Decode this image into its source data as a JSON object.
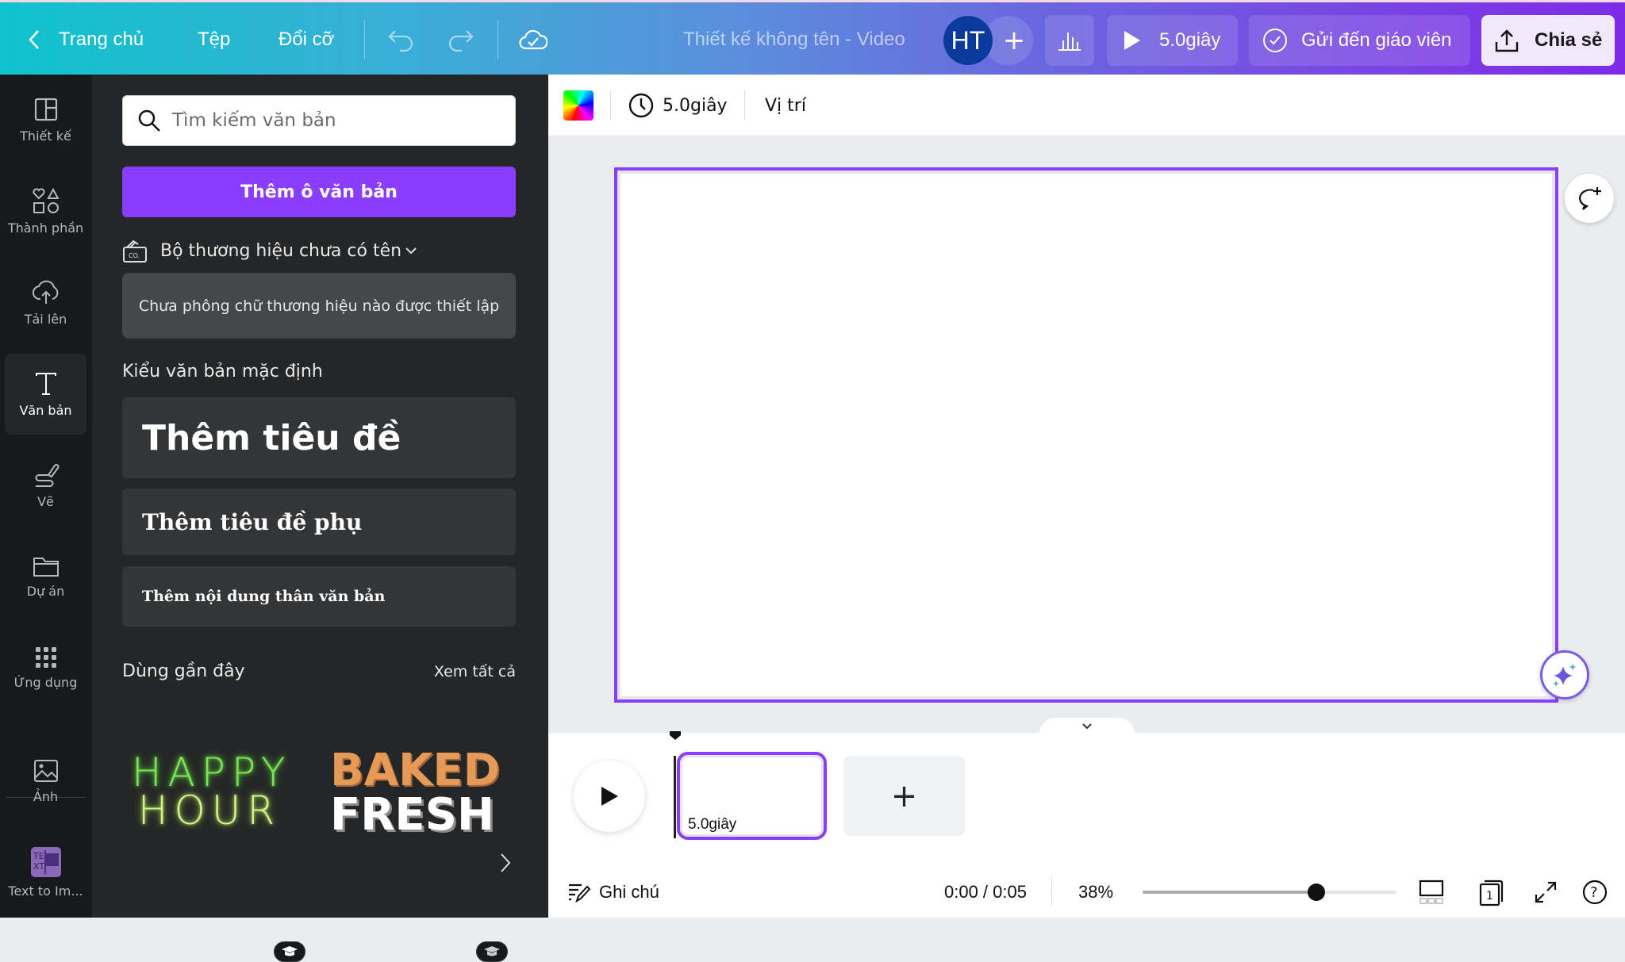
{
  "topbar": {
    "back_label": "Trang chủ",
    "file_label": "Tệp",
    "resize_label": "Đổi cỡ",
    "design_title": "Thiết kế không tên - Video",
    "avatar_initials": "HT",
    "add_collaborator": "+",
    "play_duration": "5.0giây",
    "send_to_teacher": "Gửi đến giáo viên",
    "share_label": "Chia sẻ",
    "colors": {
      "gradient_start": "#0fc3cc",
      "gradient_end": "#7d2ae8",
      "avatar_bg": "#0a3a9c"
    }
  },
  "rail": {
    "items": [
      {
        "label": "Thiết kế",
        "icon": "layout-icon"
      },
      {
        "label": "Thành phần",
        "icon": "elements-icon"
      },
      {
        "label": "Tải lên",
        "icon": "upload-cloud-icon"
      },
      {
        "label": "Văn bản",
        "icon": "text-icon",
        "active": true
      },
      {
        "label": "Vẽ",
        "icon": "draw-icon"
      },
      {
        "label": "Dự án",
        "icon": "folder-icon"
      },
      {
        "label": "Ứng dụng",
        "icon": "apps-grid-icon"
      },
      {
        "label": "Ảnh",
        "icon": "image-icon"
      },
      {
        "label": "Text to Im...",
        "icon": "text-to-image-icon"
      }
    ]
  },
  "panel": {
    "search_placeholder": "Tìm kiếm văn bản",
    "search_value": "",
    "add_textbox": "Thêm ô văn bản",
    "brand_kit": "Bộ thương hiệu chưa có tên",
    "brand_note": "Chưa phông chữ thương hiệu nào được thiết lập",
    "default_styles_title": "Kiểu văn bản mặc định",
    "heading": "Thêm tiêu đề",
    "subheading": "Thêm tiêu đề phụ",
    "body": "Thêm nội dung thân văn bản",
    "recent_title": "Dùng gần đây",
    "see_all": "Xem tất cả",
    "recent": [
      {
        "line1": "HAPPY",
        "line2": "HOUR"
      },
      {
        "line1": "BAKED",
        "line2": "FRESH"
      }
    ],
    "accent": "#8b3dff"
  },
  "context_bar": {
    "duration": "5.0giây",
    "position": "Vị trí"
  },
  "timeline": {
    "scene_duration": "5.0giây",
    "add_scene": "+"
  },
  "footer": {
    "notes": "Ghi chú",
    "time": "0:00 / 0:05",
    "zoom_percent": "38%",
    "zoom_fraction": 0.38,
    "page_number": "1",
    "help": "?"
  }
}
